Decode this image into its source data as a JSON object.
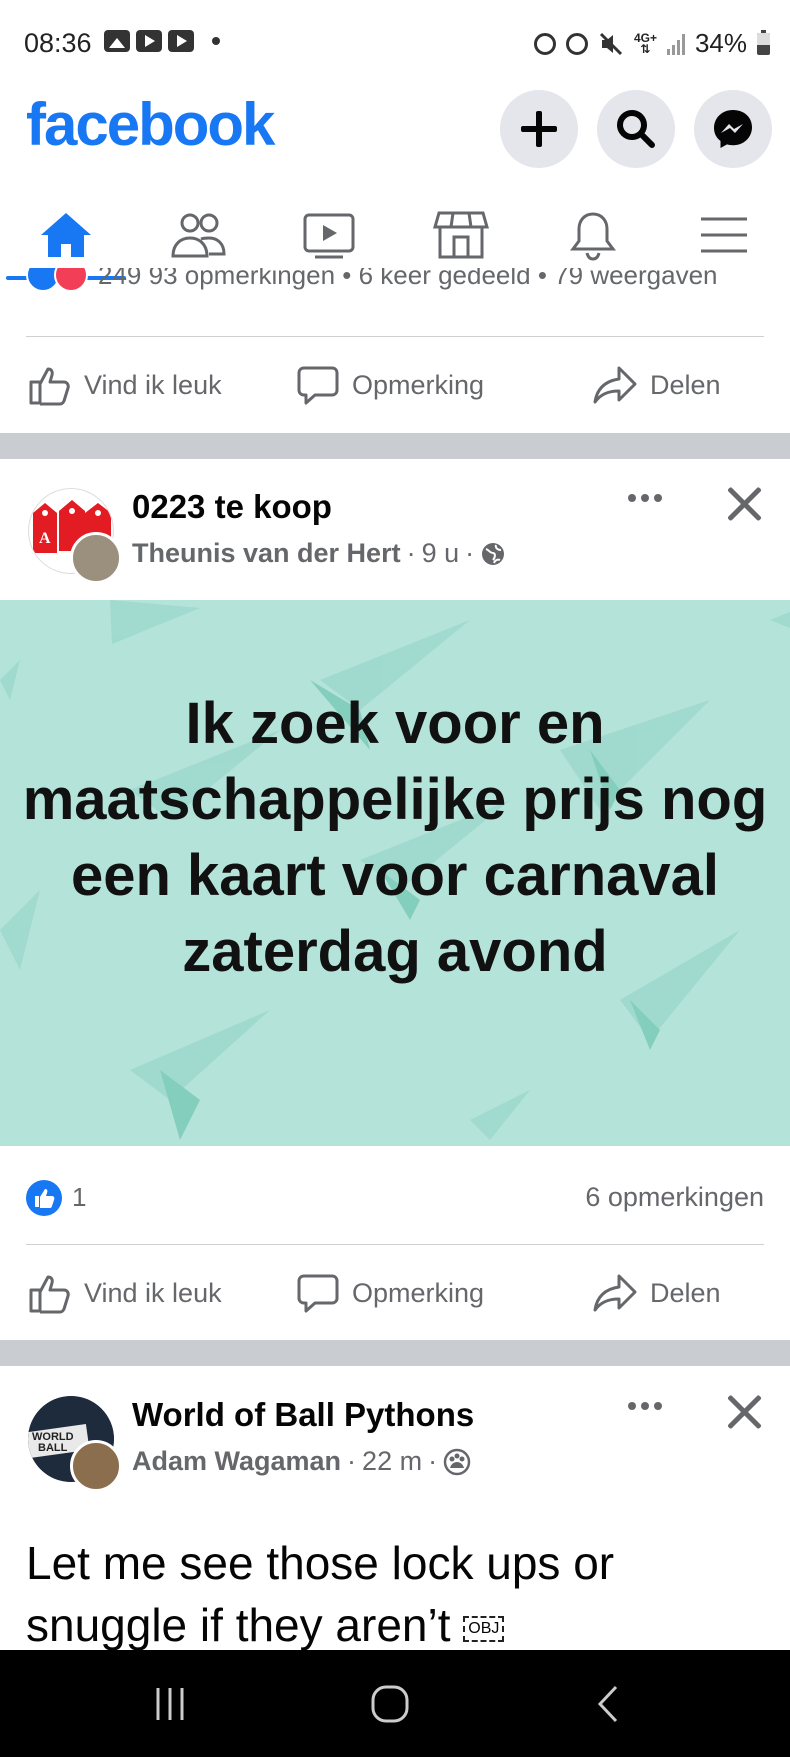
{
  "status_bar": {
    "time": "08:36",
    "network": "4G+",
    "battery": "34%"
  },
  "header": {
    "logo": "facebook",
    "brand_color": "#1877f2",
    "actions": [
      "plus-icon",
      "search-icon",
      "messenger-icon"
    ]
  },
  "tabs": [
    {
      "name": "home",
      "icon": "home-icon",
      "active": true
    },
    {
      "name": "friends",
      "icon": "friends-icon",
      "active": false
    },
    {
      "name": "watch",
      "icon": "video-icon",
      "active": false
    },
    {
      "name": "marketplace",
      "icon": "marketplace-icon",
      "active": false
    },
    {
      "name": "notifications",
      "icon": "bell-icon",
      "active": false
    },
    {
      "name": "menu",
      "icon": "menu-icon",
      "active": false
    }
  ],
  "previous_post": {
    "stats": "249   93 opmerkingen • 6 keer gedeeld • 79 weergaven"
  },
  "actions": {
    "like": "Vind ik leuk",
    "comment": "Opmerking",
    "share": "Delen"
  },
  "post1": {
    "group": "0223 te koop",
    "author": "Theunis van der Hert",
    "time": "9 u",
    "privacy_icon": "globe-icon",
    "text": "Ik zoek voor en maatschappelijke prijs nog een kaart voor carnaval zaterdag avond",
    "background_color": "#b4e3da",
    "likes": "1",
    "comments": "6 opmerkingen"
  },
  "post2": {
    "group": "World of Ball Pythons",
    "author": "Adam Wagaman",
    "time": "22 m",
    "privacy_icon": "group-icon",
    "text": "Let me see those lock ups  or snuggle if they aren’t",
    "obj_placeholder": "OBJ"
  }
}
